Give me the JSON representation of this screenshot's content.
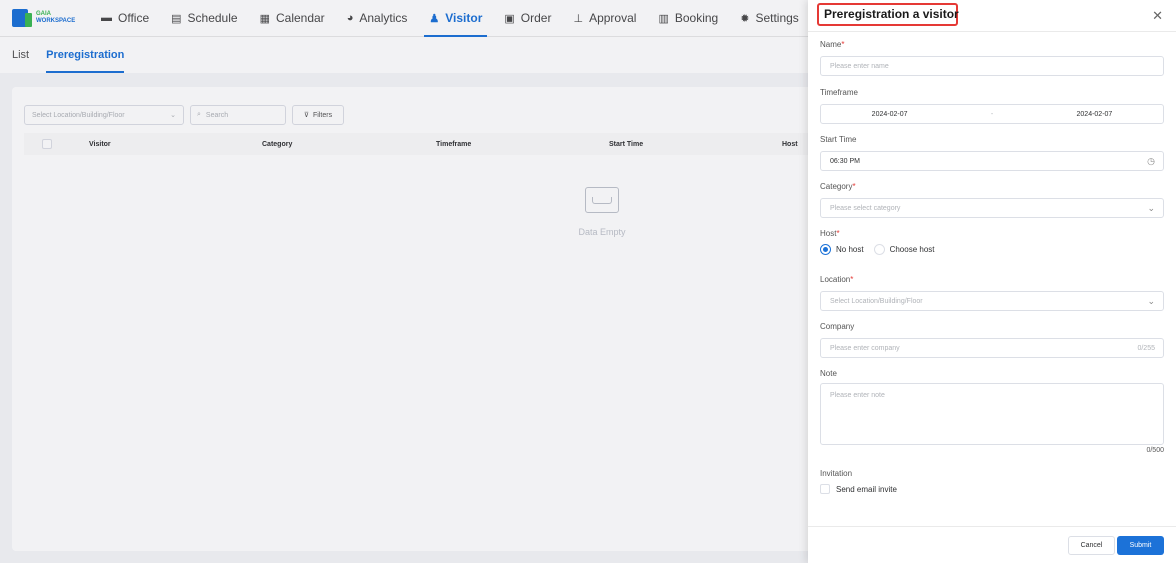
{
  "brand": {
    "line1": "GAIA",
    "line2": "WORKSPACE",
    "primary_color": "#1c72d8",
    "accent_color": "#3cba54"
  },
  "nav": [
    {
      "label": "Office",
      "icon": "office-icon"
    },
    {
      "label": "Schedule",
      "icon": "schedule-icon"
    },
    {
      "label": "Calendar",
      "icon": "calendar-icon"
    },
    {
      "label": "Analytics",
      "icon": "analytics-icon"
    },
    {
      "label": "Visitor",
      "icon": "visitor-icon",
      "active": true
    },
    {
      "label": "Order",
      "icon": "order-icon"
    },
    {
      "label": "Approval",
      "icon": "approval-icon"
    },
    {
      "label": "Booking",
      "icon": "booking-icon"
    },
    {
      "label": "Settings",
      "icon": "gear-icon"
    }
  ],
  "subtabs": [
    {
      "label": "List"
    },
    {
      "label": "Preregistration",
      "active": true
    }
  ],
  "filters": {
    "location_placeholder": "Select Location/Building/Floor",
    "search_placeholder": "Search",
    "filters_label": "Filters"
  },
  "table": {
    "columns": [
      "Visitor",
      "Category",
      "Timeframe",
      "Start Time",
      "Host"
    ],
    "empty_text": "Data Empty"
  },
  "drawer": {
    "title": "Preregistration a visitor",
    "name": {
      "label": "Name",
      "placeholder": "Please enter name"
    },
    "timeframe": {
      "label": "Timeframe",
      "start": "2024-02-07",
      "separator": "-",
      "end": "2024-02-07"
    },
    "start_time": {
      "label": "Start Time",
      "value": "06:30 PM"
    },
    "category": {
      "label": "Category",
      "placeholder": "Please select category"
    },
    "host": {
      "label": "Host",
      "option_none": "No host",
      "option_choose": "Choose host",
      "selected": "No host"
    },
    "location": {
      "label": "Location",
      "placeholder": "Select Location/Building/Floor"
    },
    "company": {
      "label": "Company",
      "placeholder": "Please enter company",
      "counter": "0/255"
    },
    "note": {
      "label": "Note",
      "placeholder": "Please enter note",
      "counter": "0/500"
    },
    "invitation": {
      "label": "Invitation",
      "checkbox_label": "Send email invite"
    },
    "cancel_label": "Cancel",
    "submit_label": "Submit"
  }
}
